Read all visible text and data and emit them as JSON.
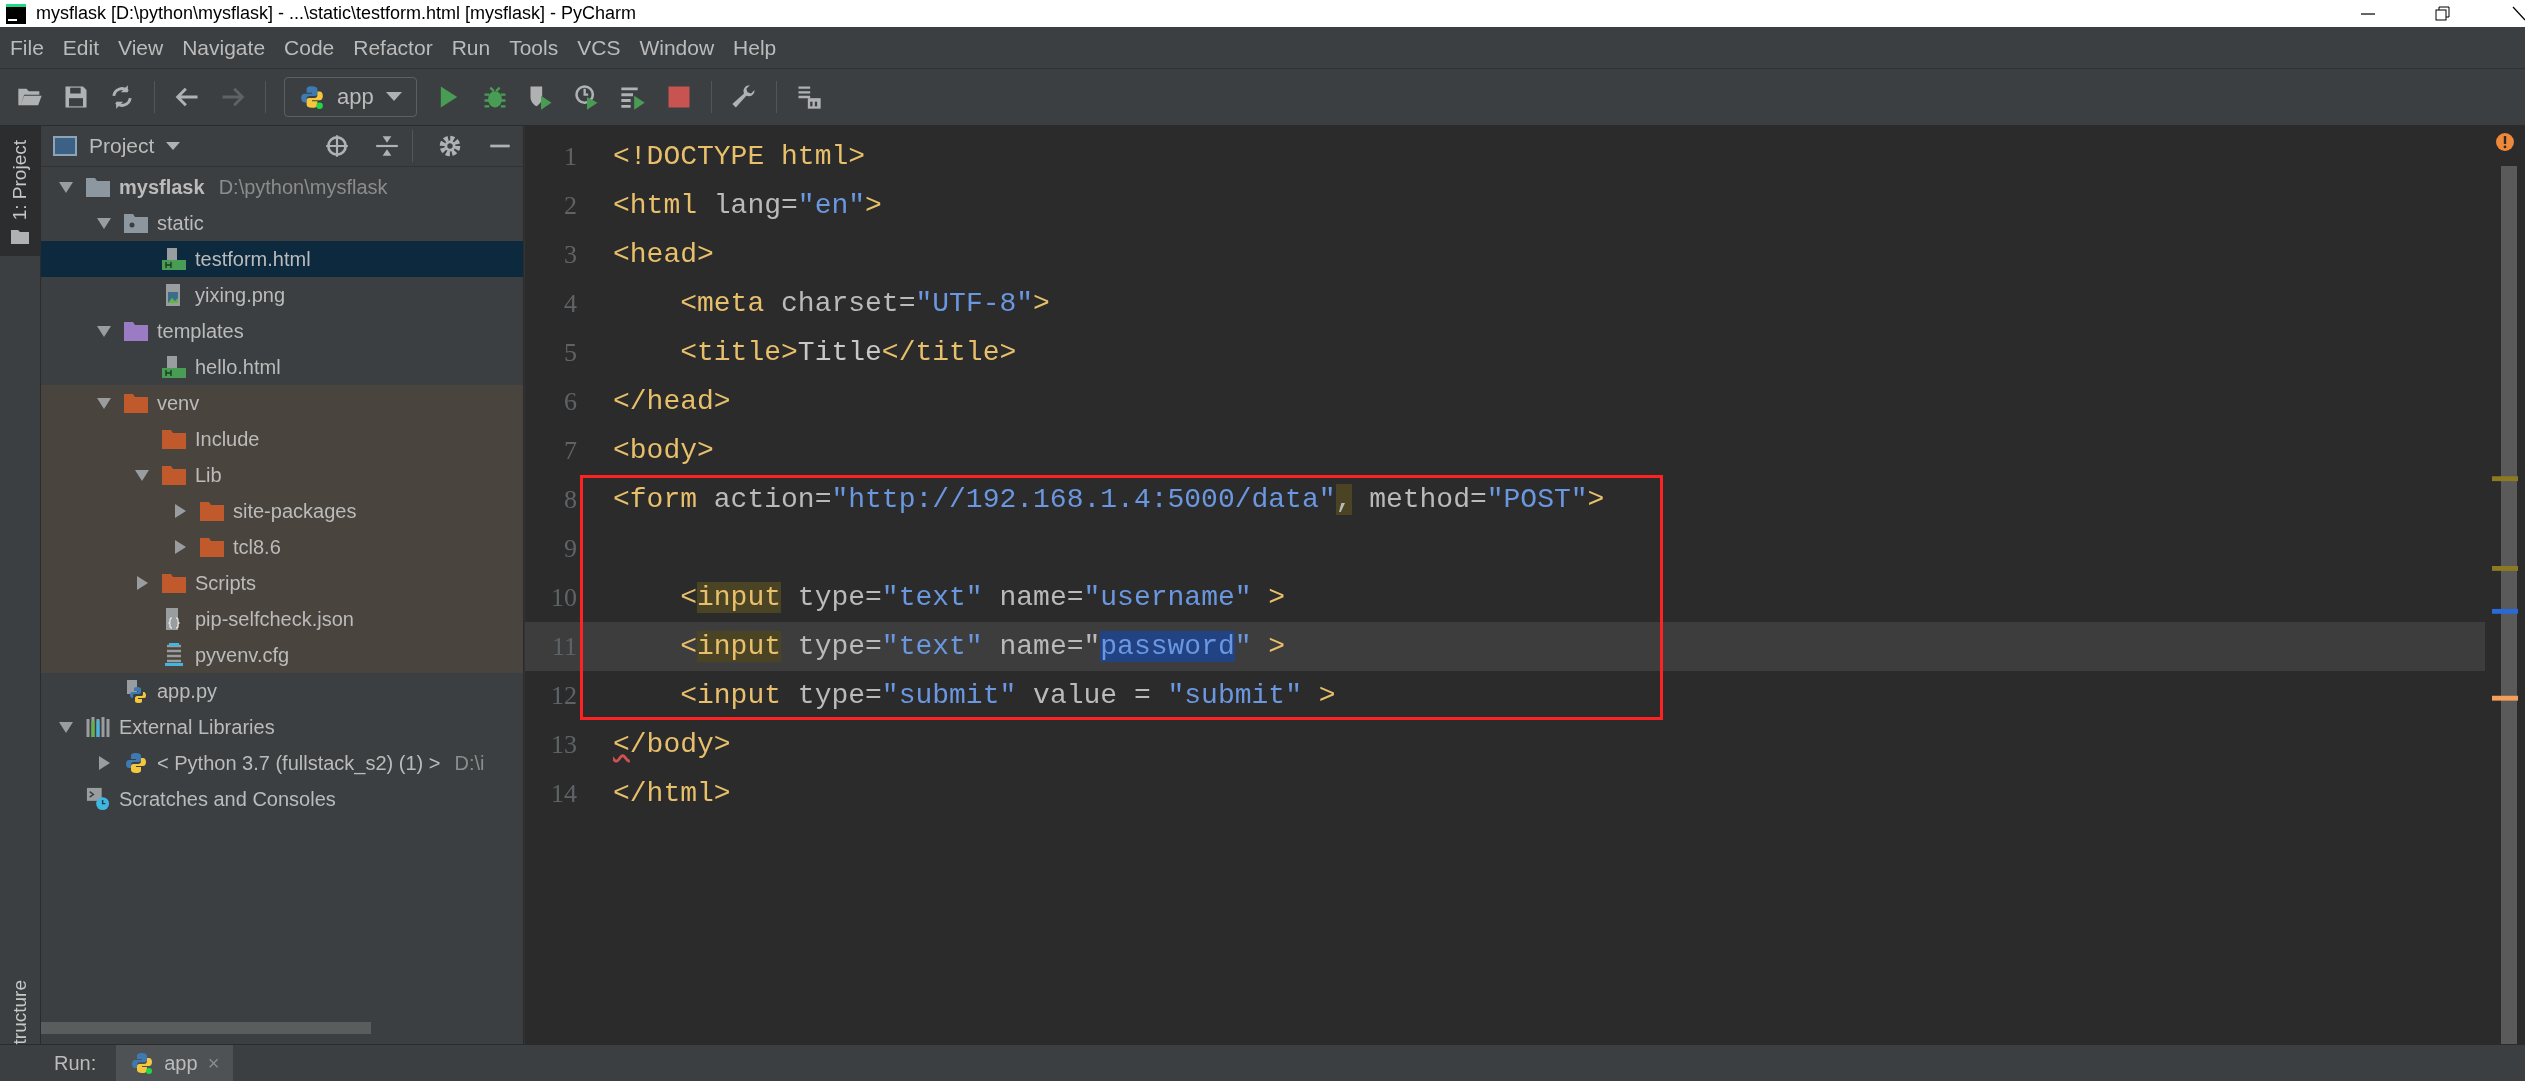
{
  "window": {
    "title": "mysflask [D:\\python\\mysflask] - ...\\static\\testform.html [mysflask] - PyCharm"
  },
  "menu": [
    "File",
    "Edit",
    "View",
    "Navigate",
    "Code",
    "Refactor",
    "Run",
    "Tools",
    "VCS",
    "Window",
    "Help"
  ],
  "toolbar": {
    "run_config": "app"
  },
  "tool_stripe": {
    "top_tab": {
      "label": "1: Project",
      "selected": true
    },
    "bottom_tab": {
      "label": "tructure"
    }
  },
  "project": {
    "title": "Project",
    "tree": [
      {
        "name": "mysflask",
        "hint": "D:\\python\\mysflask",
        "kind": "folder",
        "expanded": true,
        "selected": false,
        "children": [
          {
            "name": "static",
            "kind": "resource-folder",
            "expanded": true,
            "selected": false,
            "children": [
              {
                "name": "testform.html",
                "kind": "html",
                "selected": true
              },
              {
                "name": "yixing.png",
                "kind": "image",
                "selected": false
              }
            ]
          },
          {
            "name": "templates",
            "kind": "template-folder",
            "expanded": true,
            "selected": false,
            "children": [
              {
                "name": "hello.html",
                "kind": "html",
                "selected": false
              }
            ]
          },
          {
            "name": "venv",
            "kind": "excluded-folder",
            "expanded": true,
            "selected": false,
            "excluded": true,
            "children": [
              {
                "name": "Include",
                "kind": "excluded-folder",
                "selected": false
              },
              {
                "name": "Lib",
                "kind": "excluded-folder",
                "expanded": true,
                "selected": false,
                "children": [
                  {
                    "name": "site-packages",
                    "kind": "excluded-folder",
                    "expanded": false,
                    "selected": false
                  },
                  {
                    "name": "tcl8.6",
                    "kind": "excluded-folder",
                    "expanded": false,
                    "selected": false
                  }
                ]
              },
              {
                "name": "Scripts",
                "kind": "excluded-folder",
                "expanded": false,
                "selected": false
              },
              {
                "name": "pip-selfcheck.json",
                "kind": "json",
                "selected": false
              },
              {
                "name": "pyvenv.cfg",
                "kind": "config",
                "selected": false
              }
            ]
          },
          {
            "name": "app.py",
            "kind": "python",
            "selected": false
          }
        ]
      },
      {
        "name": "External Libraries",
        "kind": "library",
        "expanded": true,
        "selected": false,
        "children": [
          {
            "name": "< Python 3.7 (fullstack_s2) (1) >",
            "hint": "D:\\i",
            "kind": "sdk",
            "expanded": false,
            "selected": false
          }
        ]
      },
      {
        "name": "Scratches and Consoles",
        "kind": "scratches",
        "selected": false
      }
    ]
  },
  "editor": {
    "lines": [
      {
        "number": "1",
        "boxed": false,
        "current": false,
        "tokens": [
          {
            "text": "<!DOCTYPE html>",
            "kind": "tag"
          }
        ]
      },
      {
        "number": "2",
        "boxed": false,
        "current": false,
        "tokens": [
          {
            "text": "<html",
            "kind": "tag"
          },
          {
            "text": " lang=",
            "kind": "attr"
          },
          {
            "text": "\"en\"",
            "kind": "string"
          },
          {
            "text": ">",
            "kind": "tag"
          }
        ]
      },
      {
        "number": "3",
        "boxed": false,
        "current": false,
        "tokens": [
          {
            "text": "<head>",
            "kind": "tag"
          }
        ]
      },
      {
        "number": "4",
        "boxed": false,
        "current": false,
        "tokens": [
          {
            "text": "    <meta",
            "kind": "tag"
          },
          {
            "text": " charset=",
            "kind": "attr"
          },
          {
            "text": "\"UTF-8\"",
            "kind": "string"
          },
          {
            "text": ">",
            "kind": "tag"
          }
        ]
      },
      {
        "number": "5",
        "boxed": false,
        "current": false,
        "tokens": [
          {
            "text": "    <title>",
            "kind": "tag"
          },
          {
            "text": "Title",
            "kind": "text"
          },
          {
            "text": "</title>",
            "kind": "tag"
          }
        ]
      },
      {
        "number": "6",
        "boxed": false,
        "current": false,
        "tokens": [
          {
            "text": "</head>",
            "kind": "tag"
          }
        ]
      },
      {
        "number": "7",
        "boxed": false,
        "current": false,
        "tokens": [
          {
            "text": "<body>",
            "kind": "tag"
          }
        ]
      },
      {
        "number": "8",
        "boxed": true,
        "current": false,
        "tokens": [
          {
            "text": "<form",
            "kind": "tag"
          },
          {
            "text": " action=",
            "kind": "attr"
          },
          {
            "text": "\"http://192.168.1.4:5000/data\"",
            "kind": "string"
          },
          {
            "text": ",",
            "kind": "attr",
            "usage_highlight": true
          },
          {
            "text": " method=",
            "kind": "attr"
          },
          {
            "text": "\"POST\"",
            "kind": "string"
          },
          {
            "text": ">",
            "kind": "tag"
          }
        ]
      },
      {
        "number": "9",
        "boxed": true,
        "current": false
      },
      {
        "number": "10",
        "boxed": true,
        "current": false,
        "tokens": [
          {
            "text": "    <",
            "kind": "tag"
          },
          {
            "text": "input",
            "kind": "tag",
            "usage_highlight": true
          },
          {
            "text": " type=",
            "kind": "attr"
          },
          {
            "text": "\"text\"",
            "kind": "string"
          },
          {
            "text": " name=",
            "kind": "attr"
          },
          {
            "text": "\"username\"",
            "kind": "string"
          },
          {
            "text": " >",
            "kind": "tag"
          }
        ]
      },
      {
        "number": "11",
        "boxed": true,
        "current": true,
        "tokens": [
          {
            "text": "    <",
            "kind": "tag"
          },
          {
            "text": "input",
            "kind": "tag",
            "usage_highlight": true
          },
          {
            "text": " type=",
            "kind": "attr"
          },
          {
            "text": "\"text\"",
            "kind": "string"
          },
          {
            "text": " name=\"",
            "kind": "attr"
          },
          {
            "text": "password",
            "kind": "string",
            "text_selected": true
          },
          {
            "text": "\"",
            "kind": "string"
          },
          {
            "text": " >",
            "kind": "tag"
          }
        ]
      },
      {
        "number": "12",
        "boxed": true,
        "current": false,
        "tokens": [
          {
            "text": "    <input",
            "kind": "tag"
          },
          {
            "text": " type=",
            "kind": "attr"
          },
          {
            "text": "\"submit\"",
            "kind": "string"
          },
          {
            "text": " value = ",
            "kind": "attr"
          },
          {
            "text": "\"submit\"",
            "kind": "string"
          },
          {
            "text": " >",
            "kind": "tag"
          }
        ]
      },
      {
        "number": "13",
        "boxed": false,
        "current": false,
        "tokens": [
          {
            "text": "<",
            "kind": "tag",
            "error": true
          },
          {
            "text": "/body>",
            "kind": "tag"
          }
        ]
      },
      {
        "number": "14",
        "boxed": false,
        "current": false,
        "tokens": [
          {
            "text": "</html>",
            "kind": "tag"
          }
        ]
      }
    ]
  },
  "run_bar": {
    "label": "Run:",
    "tabs": [
      {
        "label": "app",
        "close": "×",
        "selected": true
      }
    ]
  }
}
